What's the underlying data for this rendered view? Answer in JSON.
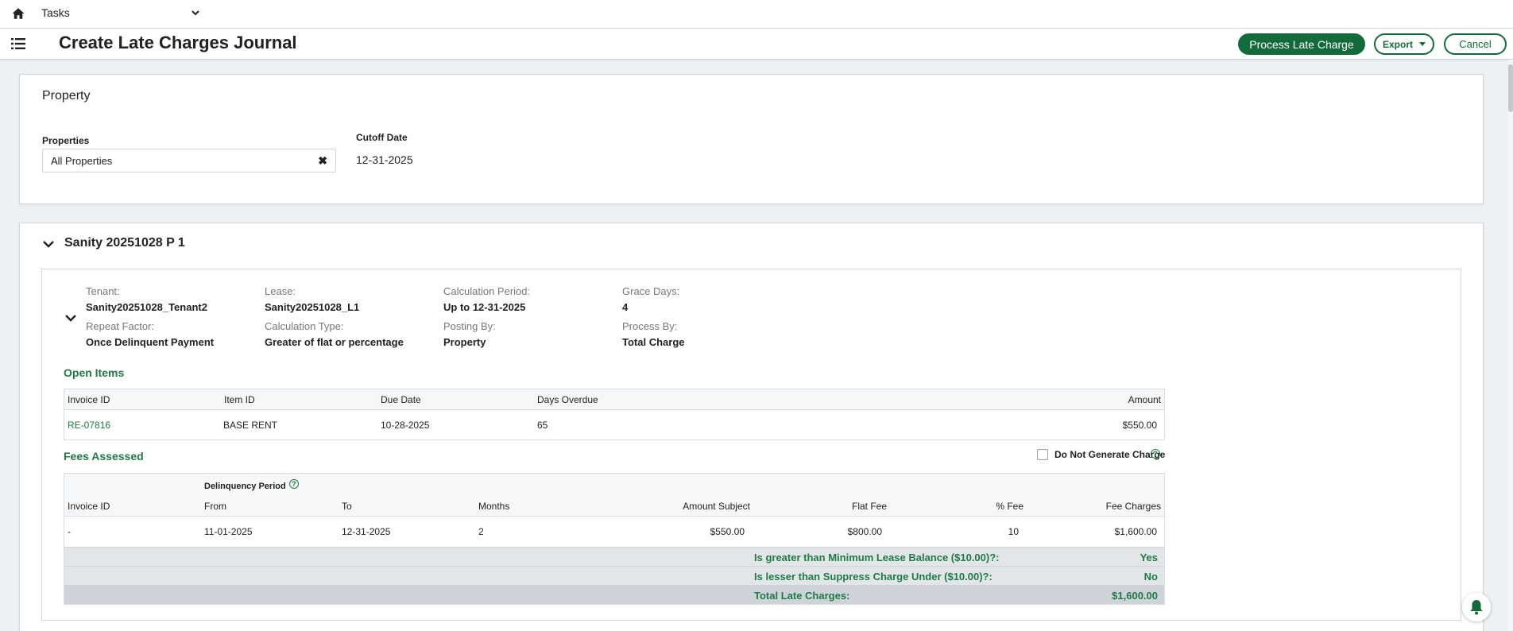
{
  "topnav": {
    "module": "Tasks"
  },
  "header": {
    "title": "Create Late Charges Journal",
    "process_label": "Process Late Charge",
    "export_label": "Export",
    "cancel_label": "Cancel"
  },
  "property_card": {
    "title": "Property",
    "properties_label": "Properties",
    "properties_value": "All Properties",
    "cutoff_label": "Cutoff Date",
    "cutoff_value": "12-31-2025"
  },
  "group": {
    "title": "Sanity 20251028 P 1",
    "tenant_label": "Tenant:",
    "tenant_value": "Sanity20251028_Tenant2",
    "lease_label": "Lease:",
    "lease_value": "Sanity20251028_L1",
    "calc_period_label": "Calculation Period:",
    "calc_period_value": "Up to 12-31-2025",
    "grace_label": "Grace Days:",
    "grace_value": "4",
    "repeat_label": "Repeat Factor:",
    "repeat_value": "Once Delinquent Payment",
    "calc_type_label": "Calculation Type:",
    "calc_type_value": "Greater of flat or percentage",
    "posting_label": "Posting By:",
    "posting_value": "Property",
    "process_by_label": "Process By:",
    "process_by_value": "Total Charge"
  },
  "open_items": {
    "title": "Open Items",
    "headers": [
      "Invoice ID",
      "Item ID",
      "Due Date",
      "Days Overdue",
      "Amount"
    ],
    "rows": [
      {
        "invoice": "RE-07816",
        "item": "BASE RENT",
        "due": "10-28-2025",
        "days": "65",
        "amount": "$550.00"
      }
    ]
  },
  "fees": {
    "title": "Fees Assessed",
    "dng_label": "Do Not Generate Charge",
    "dng_checked": false,
    "period_label": "Delinquency Period",
    "headers": [
      "Invoice ID",
      "From",
      "To",
      "Months",
      "Amount Subject",
      "Flat Fee",
      "% Fee",
      "Fee Charges"
    ],
    "rows": [
      {
        "invoice": "-",
        "from": "11-01-2025",
        "to": "12-31-2025",
        "months": "2",
        "subject": "$550.00",
        "flat": "$800.00",
        "pct": "10",
        "charges": "$1,600.00"
      }
    ],
    "min_balance_label": "Is greater than Minimum Lease Balance ($10.00)?:",
    "min_balance_value": "Yes",
    "suppress_label": "Is lesser than Suppress Charge Under ($10.00)?:",
    "suppress_value": "No",
    "total_label": "Total Late Charges:",
    "total_value": "$1,600.00"
  },
  "colors": {
    "brand": "#136b3c",
    "accent_text": "#1f7a46"
  },
  "icons": [
    "home-icon",
    "chevron-down-icon",
    "list-menu-icon",
    "close-icon",
    "help-icon",
    "bell-icon"
  ]
}
